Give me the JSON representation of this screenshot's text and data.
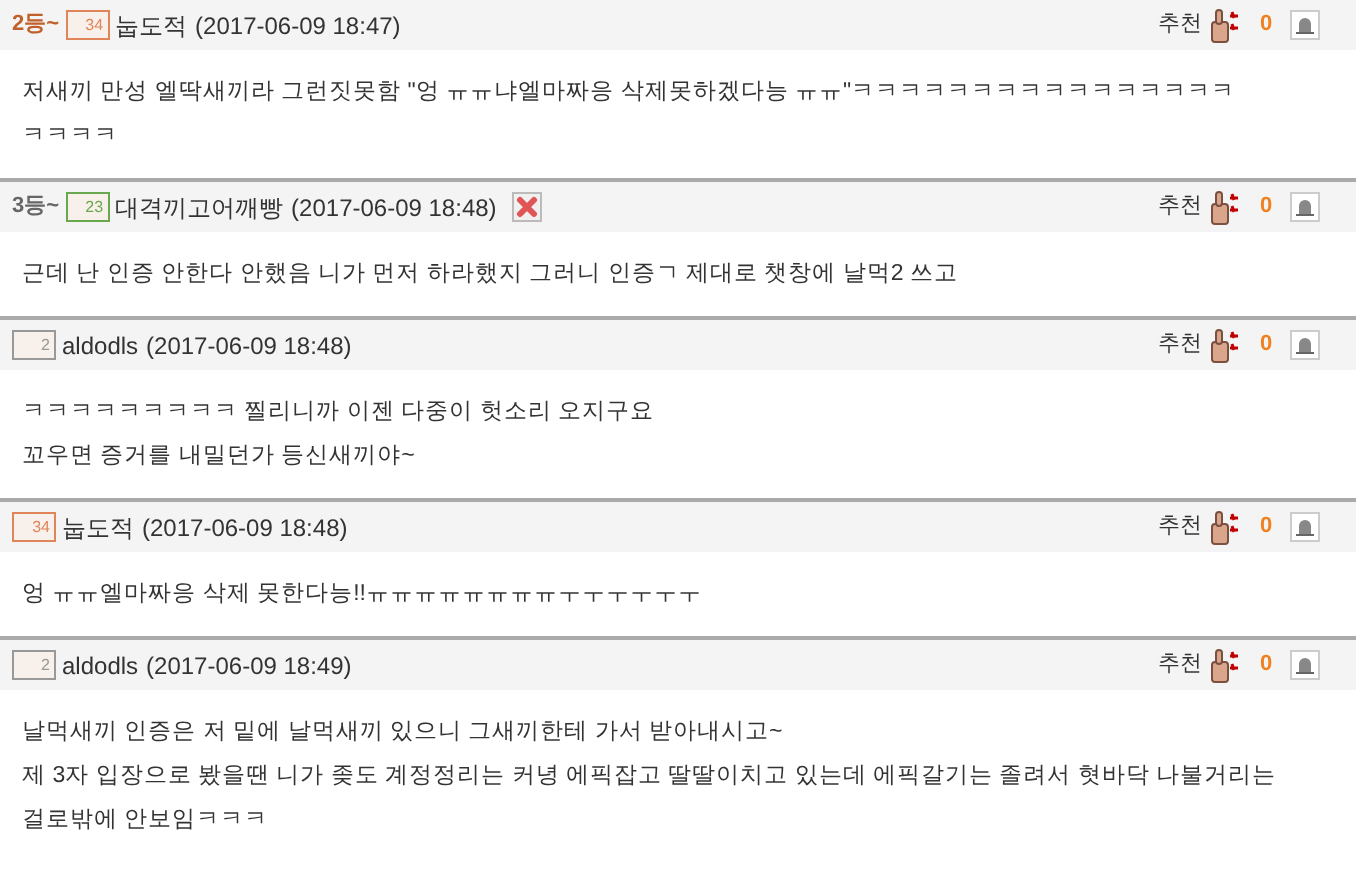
{
  "comments": [
    {
      "rank": {
        "text": "2등~",
        "color": "#c0602a"
      },
      "badge": {
        "text": "34",
        "color": "#e0845a"
      },
      "author": "눕도적",
      "time": "(2017-06-09 18:47)",
      "deletable": false,
      "recommend_label": "추천",
      "votes": "0",
      "lines": [
        "저새끼 만성 엘딱새끼라 그런짓못함 \"엉 ㅠㅠ냐엘마짜응 삭제못하겠다능 ㅠㅠ\"ㅋㅋㅋㅋㅋㅋㅋㅋㅋㅋㅋㅋㅋㅋㅋㅋ",
        "ㅋㅋㅋㅋ"
      ]
    },
    {
      "rank": {
        "text": "3등~",
        "color": "#666666"
      },
      "badge": {
        "text": "23",
        "color": "#6aa84f"
      },
      "author": "대격끼고어깨빵",
      "time": "(2017-06-09 18:48)",
      "deletable": true,
      "recommend_label": "추천",
      "votes": "0",
      "lines": [
        "근데 난 인증 안한다 안했음 니가 먼저 하라했지 그러니 인증ㄱ 제대로 챗창에 날먹2 쓰고"
      ]
    },
    {
      "badge": {
        "text": "2",
        "color": "#999999"
      },
      "author": "aldodls",
      "time": "(2017-06-09 18:48)",
      "deletable": false,
      "recommend_label": "추천",
      "votes": "0",
      "lines": [
        "ㅋㅋㅋㅋㅋㅋㅋㅋㅋ 찔리니까 이젠 다중이 헛소리 오지구요",
        "꼬우면 증거를 내밀던가 등신새끼야~"
      ]
    },
    {
      "badge": {
        "text": "34",
        "color": "#e0845a"
      },
      "author": "눕도적",
      "time": "(2017-06-09 18:48)",
      "deletable": false,
      "recommend_label": "추천",
      "votes": "0",
      "lines": [
        "엉 ㅠㅠ엘마짜응 삭제 못한다능!!ㅠㅠㅠㅠㅠㅠㅠㅠㅜㅜㅜㅜㅜㅜ"
      ]
    },
    {
      "badge": {
        "text": "2",
        "color": "#999999"
      },
      "author": "aldodls",
      "time": "(2017-06-09 18:49)",
      "deletable": false,
      "recommend_label": "추천",
      "votes": "0",
      "lines": [
        "날먹새끼 인증은 저 밑에 날먹새끼 있으니 그새끼한테 가서 받아내시고~",
        "제 3자 입장으로 봤을땐 니가 좆도 계정정리는 커녕 에픽잡고 딸딸이치고 있는데 에픽갈기는 졸려서 혓바닥 나불거리는",
        "걸로밖에 안보임ㅋㅋㅋ"
      ]
    }
  ]
}
